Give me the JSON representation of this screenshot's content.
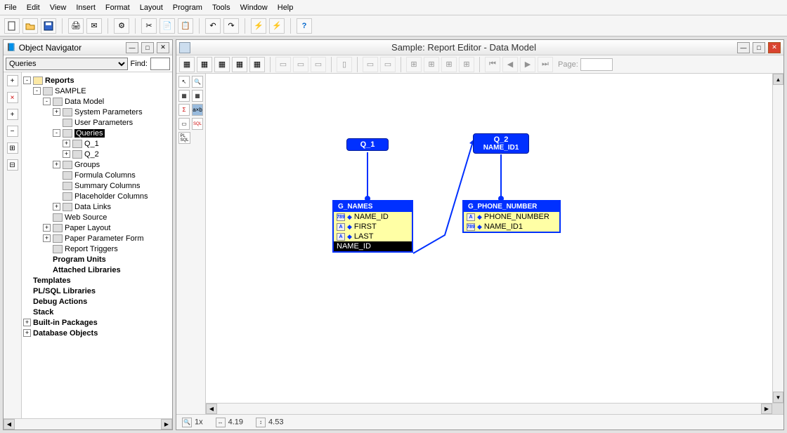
{
  "menu": [
    "File",
    "Edit",
    "View",
    "Insert",
    "Format",
    "Layout",
    "Program",
    "Tools",
    "Window",
    "Help"
  ],
  "navigator": {
    "title": "Object Navigator",
    "dropdown": "Queries",
    "find_label": "Find:",
    "find_value": "",
    "tree": [
      {
        "indent": 0,
        "exp": "-",
        "icon": "folder",
        "label": "Reports",
        "bold": true
      },
      {
        "indent": 1,
        "exp": "-",
        "icon": "doc",
        "label": "SAMPLE"
      },
      {
        "indent": 2,
        "exp": "-",
        "icon": "dm",
        "label": "Data Model"
      },
      {
        "indent": 3,
        "exp": "+",
        "icon": "p",
        "label": "System Parameters"
      },
      {
        "indent": 3,
        "exp": "",
        "icon": "p",
        "label": "User Parameters"
      },
      {
        "indent": 3,
        "exp": "-",
        "icon": "p",
        "label": "Queries",
        "selected": true
      },
      {
        "indent": 4,
        "exp": "+",
        "icon": "sql",
        "label": "Q_1"
      },
      {
        "indent": 4,
        "exp": "+",
        "icon": "sql",
        "label": "Q_2"
      },
      {
        "indent": 3,
        "exp": "+",
        "icon": "p",
        "label": "Groups"
      },
      {
        "indent": 3,
        "exp": "",
        "icon": "p",
        "label": "Formula Columns"
      },
      {
        "indent": 3,
        "exp": "",
        "icon": "p",
        "label": "Summary Columns"
      },
      {
        "indent": 3,
        "exp": "",
        "icon": "p",
        "label": "Placeholder Columns"
      },
      {
        "indent": 3,
        "exp": "+",
        "icon": "p",
        "label": "Data Links"
      },
      {
        "indent": 2,
        "exp": "",
        "icon": "web",
        "label": "Web Source"
      },
      {
        "indent": 2,
        "exp": "+",
        "icon": "pl",
        "label": "Paper Layout"
      },
      {
        "indent": 2,
        "exp": "+",
        "icon": "pp",
        "label": "Paper Parameter Form"
      },
      {
        "indent": 2,
        "exp": "",
        "icon": "rt",
        "label": "Report Triggers"
      },
      {
        "indent": 2,
        "exp": "",
        "icon": "",
        "label": "Program Units",
        "bold": true
      },
      {
        "indent": 2,
        "exp": "",
        "icon": "",
        "label": "Attached Libraries",
        "bold": true
      },
      {
        "indent": 0,
        "exp": "",
        "icon": "",
        "label": "Templates",
        "bold": true
      },
      {
        "indent": 0,
        "exp": "",
        "icon": "",
        "label": "PL/SQL Libraries",
        "bold": true
      },
      {
        "indent": 0,
        "exp": "",
        "icon": "",
        "label": "Debug Actions",
        "bold": true
      },
      {
        "indent": 0,
        "exp": "",
        "icon": "",
        "label": "Stack",
        "bold": true
      },
      {
        "indent": 0,
        "exp": "+",
        "icon": "",
        "label": "Built-in Packages",
        "bold": true
      },
      {
        "indent": 0,
        "exp": "+",
        "icon": "",
        "label": "Database Objects",
        "bold": true
      }
    ]
  },
  "editor": {
    "title": "Sample: Report Editor - Data Model",
    "page_label": "Page:",
    "page_value": "",
    "q1": "Q_1",
    "q2_top": "Q_2",
    "q2_sub": "NAME_ID1",
    "g1": {
      "title": "G_NAMES",
      "rows": [
        "NAME_ID",
        "FIRST",
        "LAST"
      ],
      "sel": "NAME_ID"
    },
    "g2": {
      "title": "G_PHONE_NUMBER",
      "rows": [
        "PHONE_NUMBER",
        "NAME_ID1"
      ]
    }
  },
  "status": {
    "zoom": "1x",
    "x": "4.19",
    "y": "4.53"
  }
}
